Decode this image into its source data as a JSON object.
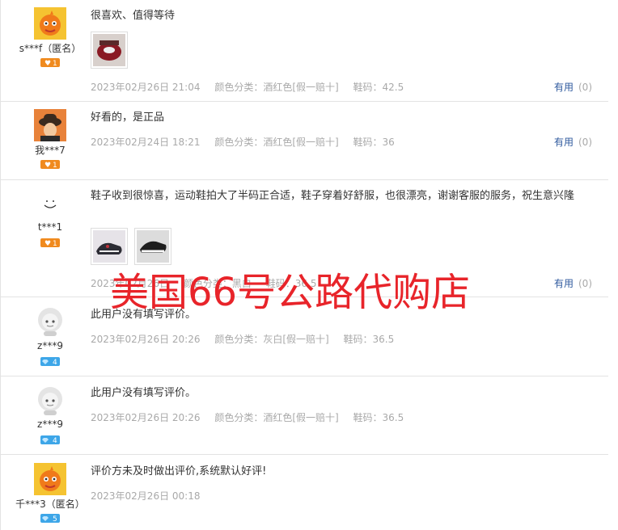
{
  "reviews": [
    {
      "user": "s***f（匿名）",
      "level": "1",
      "avatar": "orange-cartoon-avatar",
      "content": "很喜欢、值得等待",
      "date": "2023年02月26日 21:04",
      "spec": "颜色分类：酒红色[假一赔十]",
      "size": "鞋码：42.5",
      "useful_label": "有用",
      "useful_count": "(0)"
    },
    {
      "user": "我***7",
      "level": "1",
      "avatar": "bucket-hat-avatar",
      "content": "好看的，是正品",
      "date": "2023年02月24日 18:21",
      "spec": "颜色分类：酒红色[假一赔十]",
      "size": "鞋码：36",
      "useful_label": "有用",
      "useful_count": "(0)"
    },
    {
      "user": "t***1",
      "level": "1",
      "avatar": "smiley-avatar",
      "content": "鞋子收到很惊喜，运动鞋拍大了半码正合适，鞋子穿着好舒服，也很漂亮，谢谢客服的服务，祝生意兴隆",
      "date": "2023年02月26日",
      "spec": "颜色分类：黑白",
      "size": "鞋码：36.5",
      "useful_label": "有用",
      "useful_count": "(0)"
    },
    {
      "user": "z***9",
      "level": "4",
      "avatar": "default-gray-avatar",
      "content": "此用户没有填写评价。",
      "date": "2023年02月26日 20:26",
      "spec": "颜色分类：灰白[假一赔十]",
      "size": "鞋码：36.5"
    },
    {
      "user": "z***9",
      "level": "4",
      "avatar": "default-gray-avatar",
      "content": "此用户没有填写评价。",
      "date": "2023年02月26日 20:26",
      "spec": "颜色分类：酒红色[假一赔十]",
      "size": "鞋码：36.5"
    },
    {
      "user": "千***3（匿名）",
      "level": "5",
      "avatar": "orange-cartoon-avatar",
      "content": "评价方未及时做出评价,系统默认好评!",
      "date": "2023年02月26日 00:18"
    }
  ],
  "watermark": "美国66号公路代购店",
  "colors": {
    "watermark": "#e8242a",
    "useful_link": "#2f5a9e",
    "meta_gray": "#a9a9a9",
    "badge_orange": "#f08a1e",
    "badge_blue": "#3da6e8"
  }
}
